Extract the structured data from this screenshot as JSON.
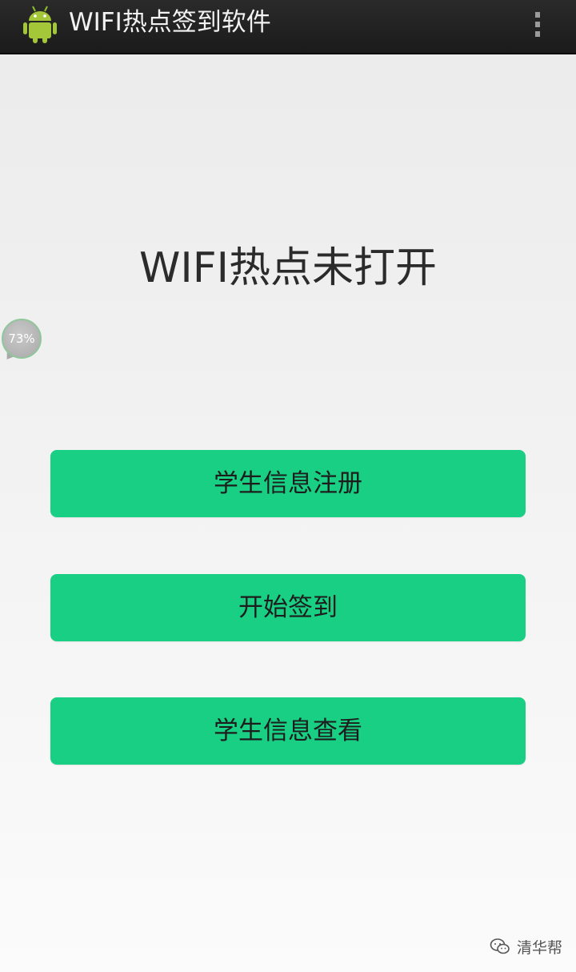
{
  "action_bar": {
    "title": "WIFI热点签到软件",
    "app_icon": "android-icon",
    "overflow_icon": "overflow-menu-icon"
  },
  "main": {
    "status_text": "WIFI热点未打开"
  },
  "buttons": {
    "register": "学生信息注册",
    "checkin": "开始签到",
    "view": "学生信息查看"
  },
  "overlay": {
    "battery_percent": "73%"
  },
  "watermark": {
    "icon": "wechat-icon",
    "text": "清华帮"
  },
  "colors": {
    "button_green": "#18cf83",
    "action_bar": "#1f1f1f",
    "android_green": "#a4c639"
  }
}
